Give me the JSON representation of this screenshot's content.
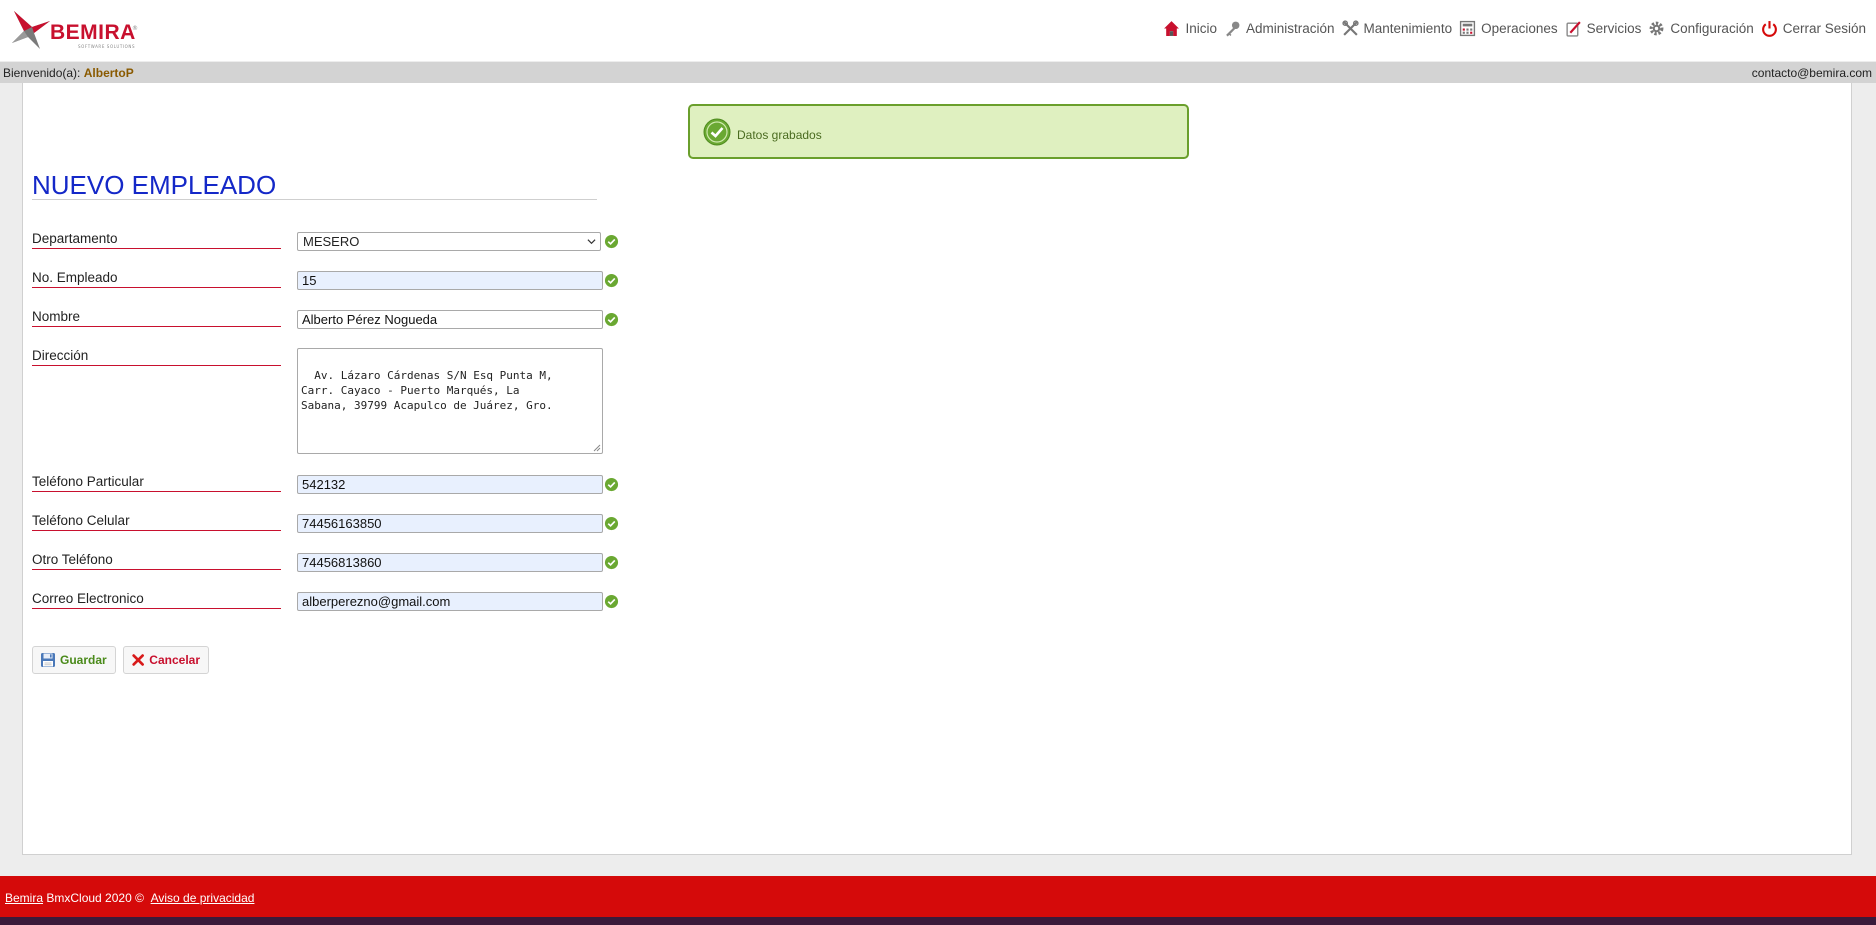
{
  "brand": {
    "name": "BEMIRA",
    "tagline": "SOFTWARE SOLUTIONS",
    "reg": "®",
    "colors": {
      "primary": "#c8102e",
      "title": "#1428c8",
      "footer": "#d50a0a"
    }
  },
  "nav": {
    "items": [
      {
        "label": "Inicio",
        "icon": "home-icon"
      },
      {
        "label": "Administración",
        "icon": "key-icon"
      },
      {
        "label": "Mantenimiento",
        "icon": "tools-icon"
      },
      {
        "label": "Operaciones",
        "icon": "calculator-icon"
      },
      {
        "label": "Servicios",
        "icon": "services-icon"
      },
      {
        "label": "Configuración",
        "icon": "gear-icon"
      },
      {
        "label": "Cerrar Sesión",
        "icon": "power-icon"
      }
    ]
  },
  "welcome": {
    "prefix": "Bienvenido(a):",
    "user": "AlbertoP",
    "contact": "contacto@bemira.com"
  },
  "message": {
    "text": "Datos grabados"
  },
  "form": {
    "title": "NUEVO EMPLEADO",
    "fields": {
      "departamento": {
        "label": "Departamento",
        "value": "MESERO"
      },
      "numero": {
        "label": "No. Empleado",
        "value": "15"
      },
      "nombre": {
        "label": "Nombre",
        "value": "Alberto Pérez Nogueda"
      },
      "direccion": {
        "label": "Dirección",
        "value": "Av. Lázaro Cárdenas S/N Esq Punta M,\nCarr. Cayaco - Puerto Marqués, La\nSabana, 39799 Acapulco de Juárez, Gro."
      },
      "tel_particular": {
        "label": "Teléfono Particular",
        "value": "542132"
      },
      "tel_celular": {
        "label": "Teléfono Celular",
        "value": "74456163850"
      },
      "otro_tel": {
        "label": "Otro Teléfono",
        "value": "74456813860"
      },
      "correo": {
        "label": "Correo Electronico",
        "value": "alberperezno@gmail.com"
      }
    },
    "buttons": {
      "save": "Guardar",
      "cancel": "Cancelar"
    }
  },
  "footer": {
    "brand_link": "Bemira",
    "text": "BmxCloud 2020 ©",
    "privacy": "Aviso de privacidad"
  }
}
